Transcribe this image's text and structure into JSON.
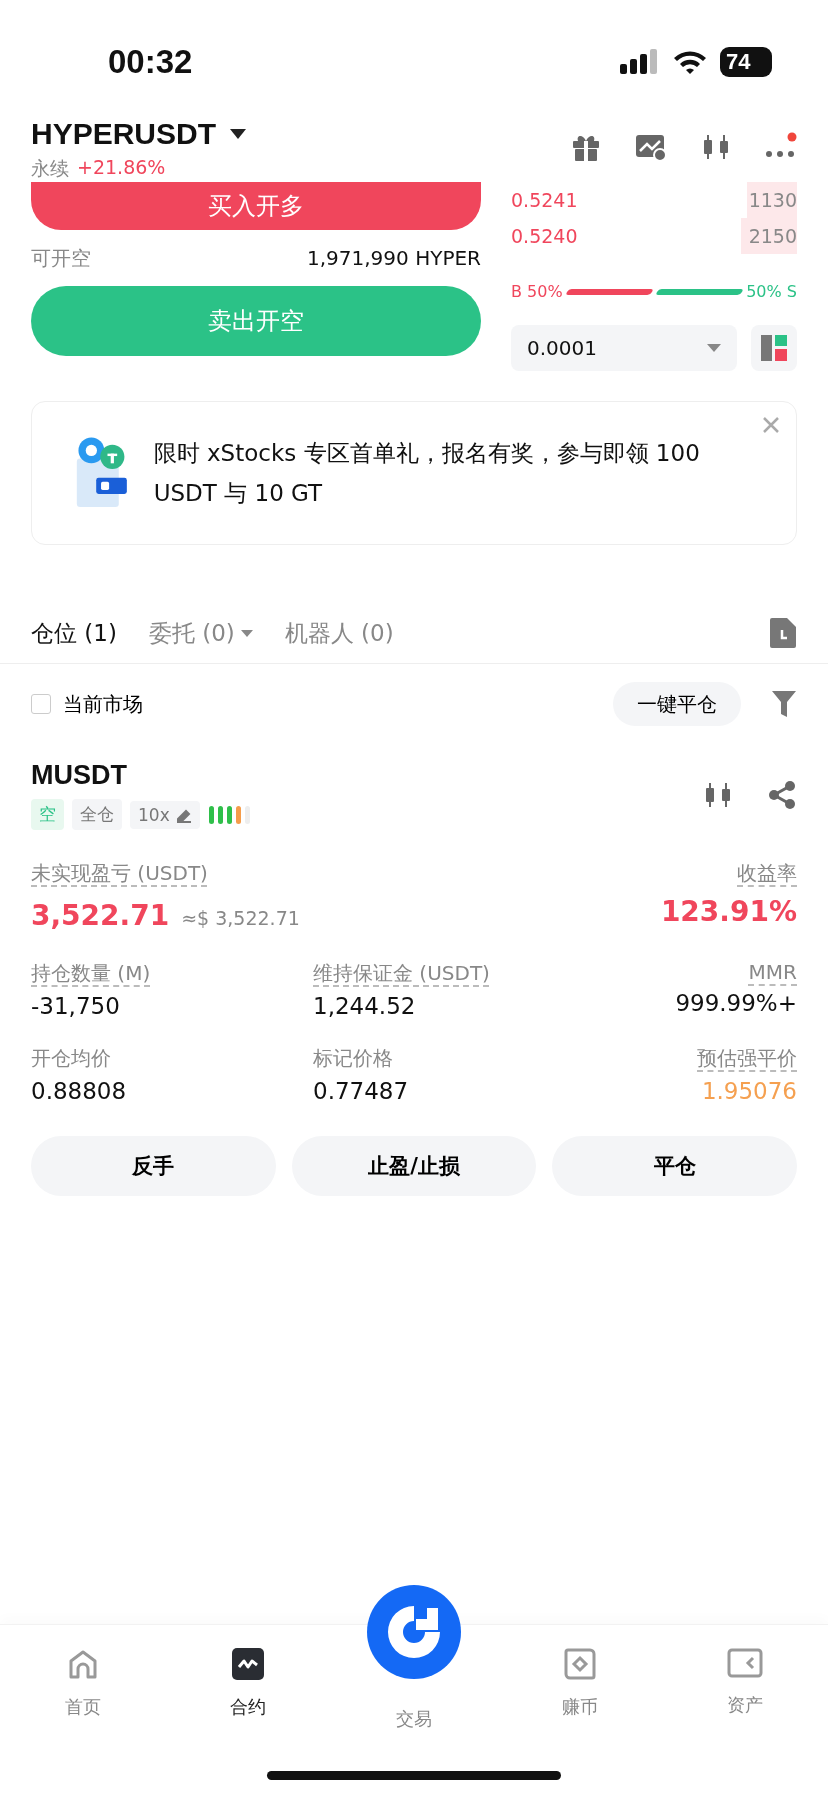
{
  "status_bar": {
    "time": "00:32",
    "battery": "74"
  },
  "header": {
    "symbol": "HYPERUSDT",
    "market_type": "永续",
    "change": "+21.86%"
  },
  "buy_button": "买入开多",
  "available": {
    "label": "可开空",
    "value": "1,971,990 HYPER"
  },
  "sell_button": "卖出开空",
  "order_book": {
    "asks": [
      {
        "price": "0.5241",
        "size": "1130"
      },
      {
        "price": "0.5240",
        "size": "2150"
      }
    ],
    "ratio": {
      "buy_label": "B 50%",
      "sell_label": "50% S"
    },
    "precision": "0.0001"
  },
  "banner": {
    "text": "限时 xStocks 专区首单礼，报名有奖，参与即领 100 USDT 与 10 GT"
  },
  "tabs": [
    {
      "label": "仓位 (1)",
      "selected": true,
      "has_menu": false
    },
    {
      "label": "委托 (0)",
      "selected": false,
      "has_menu": true
    },
    {
      "label": "机器人 (0)",
      "selected": false,
      "has_menu": false
    }
  ],
  "filter": {
    "label": "当前市场",
    "checked": false
  },
  "close_all_button": "一键平仓",
  "position": {
    "symbol": "MUSDT",
    "tags": [
      {
        "label": "空",
        "kind": "side"
      },
      {
        "label": "全仓",
        "kind": "mode"
      },
      {
        "label": "10x",
        "kind": "leverage"
      }
    ],
    "pnl": {
      "label": "未实现盈亏 (USDT)",
      "value": "3,522.71",
      "approx": "≈$ 3,522.71"
    },
    "roe": {
      "label": "收益率",
      "value": "123.91%"
    },
    "stats": [
      {
        "label": "持仓数量 (M)",
        "value": "-31,750",
        "color": "#111111",
        "dotted": true
      },
      {
        "label": "维持保证金 (USDT)",
        "value": "1,244.52",
        "color": "#111111",
        "dotted": true
      },
      {
        "label": "MMR",
        "value": "999.99%+",
        "color": "#111111",
        "dotted": true
      },
      {
        "label": "开仓均价",
        "value": "0.88808",
        "color": "#111111",
        "dotted": false
      },
      {
        "label": "标记价格",
        "value": "0.77487",
        "color": "#111111",
        "dotted": false
      },
      {
        "label": "预估强平价",
        "value": "1.95076",
        "color": "#f5a050",
        "dotted": true
      }
    ],
    "actions": [
      "反手",
      "止盈/止损",
      "平仓"
    ]
  },
  "nav": [
    {
      "label": "首页",
      "kind": "home",
      "selected": false
    },
    {
      "label": "合约",
      "kind": "futures",
      "selected": true
    },
    {
      "label": "交易",
      "kind": "trade",
      "selected": false
    },
    {
      "label": "赚币",
      "kind": "earn",
      "selected": false
    },
    {
      "label": "资产",
      "kind": "assets",
      "selected": false
    }
  ]
}
